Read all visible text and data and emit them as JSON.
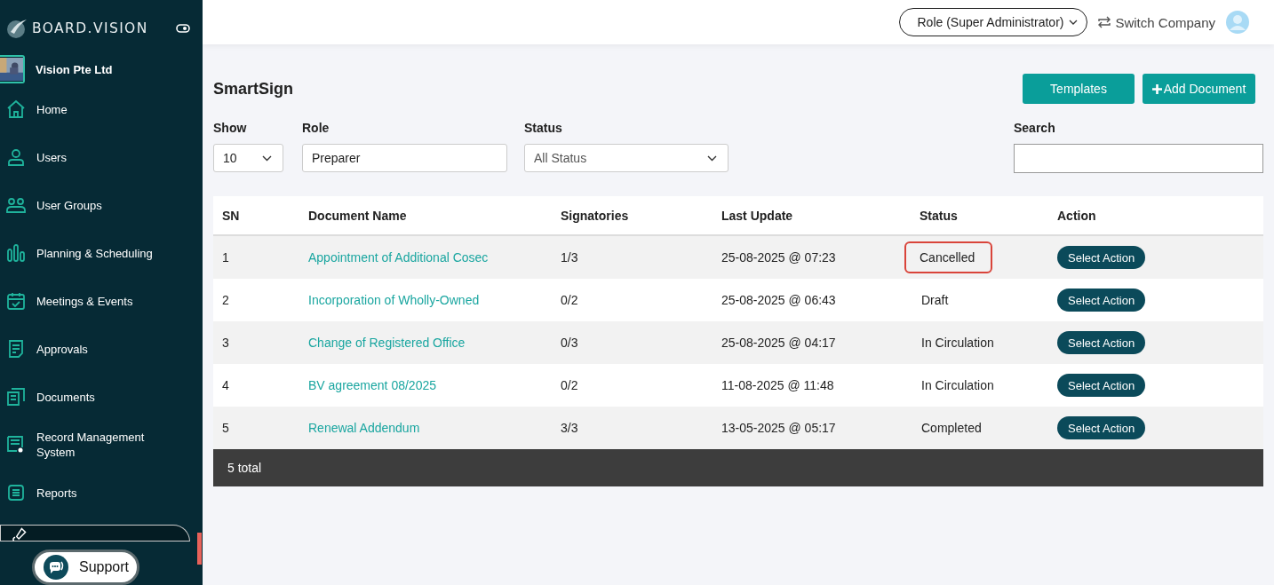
{
  "brand": "BOARD.VISION",
  "company": "Vision Pte Ltd",
  "sidebar": {
    "items": [
      {
        "label": "Home",
        "selected": false
      },
      {
        "label": "Users",
        "selected": false
      },
      {
        "label": "User Groups",
        "selected": false
      },
      {
        "label": "Planning & Scheduling",
        "selected": false
      },
      {
        "label": "Meetings & Events",
        "selected": false
      },
      {
        "label": "Approvals",
        "selected": false
      },
      {
        "label": "Documents",
        "selected": false
      },
      {
        "label": "Record Management System",
        "selected": false
      },
      {
        "label": "Reports",
        "selected": false
      },
      {
        "selected": true
      }
    ]
  },
  "support": {
    "label": "Support"
  },
  "topbar": {
    "role": "Role (Super Administrator)",
    "switch": "Switch Company"
  },
  "page": {
    "title": "SmartSign",
    "buttons": [
      {
        "label": "Templates",
        "kind": "plain"
      },
      {
        "label": "Add Document",
        "kind": "add"
      }
    ]
  },
  "filters": {
    "show": {
      "label": "Show",
      "value": "10"
    },
    "role": {
      "label": "Role",
      "value": "Preparer"
    },
    "status": {
      "label": "Status",
      "value": "All Status"
    },
    "search": {
      "label": "Search"
    }
  },
  "table": {
    "columns": [
      "SN",
      "Document Name",
      "Signatories",
      "Last Update",
      "Status",
      "Action"
    ],
    "rows": [
      {
        "sn": "1",
        "name": "Appointment of Additional Cosec",
        "signatories": "1/3",
        "updated": "25-08-2025 @ 07:23",
        "status": "Cancelled",
        "highlighted": true,
        "action": "Select Action"
      },
      {
        "sn": "2",
        "name": "Incorporation of Wholly-Owned",
        "signatories": "0/2",
        "updated": "25-08-2025 @ 06:43",
        "status": "Draft",
        "highlighted": false,
        "action": "Select Action"
      },
      {
        "sn": "3",
        "name": "Change of Registered Office",
        "signatories": "0/3",
        "updated": "25-08-2025 @ 04:17",
        "status": "In Circulation",
        "highlighted": false,
        "action": "Select Action"
      },
      {
        "sn": "4",
        "name": "BV agreement 08/2025",
        "signatories": "0/2",
        "updated": "11-08-2025 @ 11:48",
        "status": "In Circulation",
        "highlighted": false,
        "action": "Select Action"
      },
      {
        "sn": "5",
        "name": "Renewal Addendum",
        "signatories": "3/3",
        "updated": "13-05-2025 @ 05:17",
        "status": "Completed",
        "highlighted": false,
        "action": "Select Action"
      }
    ],
    "footer": "5 total"
  }
}
